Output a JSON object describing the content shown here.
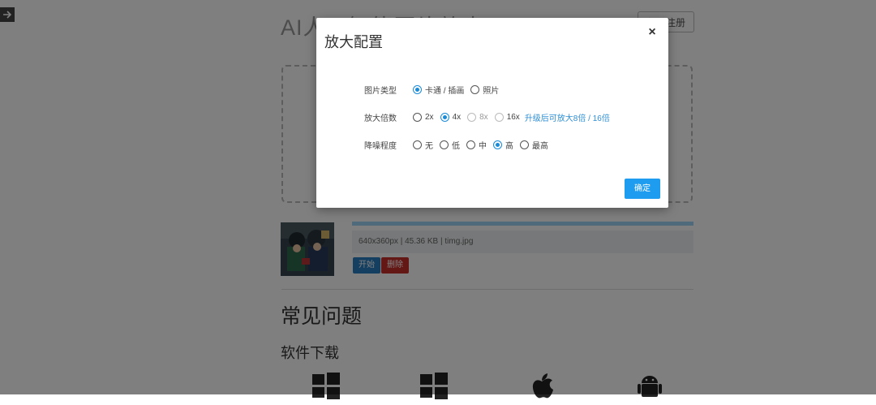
{
  "page": {
    "title": "AI人工智能图片放大",
    "login_label": "登录/注册"
  },
  "file": {
    "info": "640x360px | 45.36 KB | timg.jpg",
    "start_label": "开始",
    "delete_label": "删除",
    "progress": 1.0
  },
  "faq": {
    "title": "常见问题"
  },
  "download": {
    "title": "软件下载",
    "icons": [
      "windows-icon",
      "windows-icon",
      "apple-icon",
      "android-icon"
    ]
  },
  "modal": {
    "title": "放大配置",
    "close_label": "×",
    "ok_label": "确定",
    "rows": [
      {
        "label": "图片类型",
        "options": [
          "卡通 / 插画",
          "照片"
        ],
        "selected": 0
      },
      {
        "label": "放大倍数",
        "options": [
          "2x",
          "4x",
          "8x",
          "16x"
        ],
        "selected": 1,
        "disabled": [
          2,
          3
        ],
        "upgrade_note": "升级后可放大8倍 / 16倍"
      },
      {
        "label": "降噪程度",
        "options": [
          "无",
          "低",
          "中",
          "高",
          "最高"
        ],
        "selected": 3
      }
    ]
  },
  "colors": {
    "accent": "#1e9cf0",
    "start": "#2a7fc1",
    "delete": "#c9302c",
    "link": "#2e8fd6"
  }
}
